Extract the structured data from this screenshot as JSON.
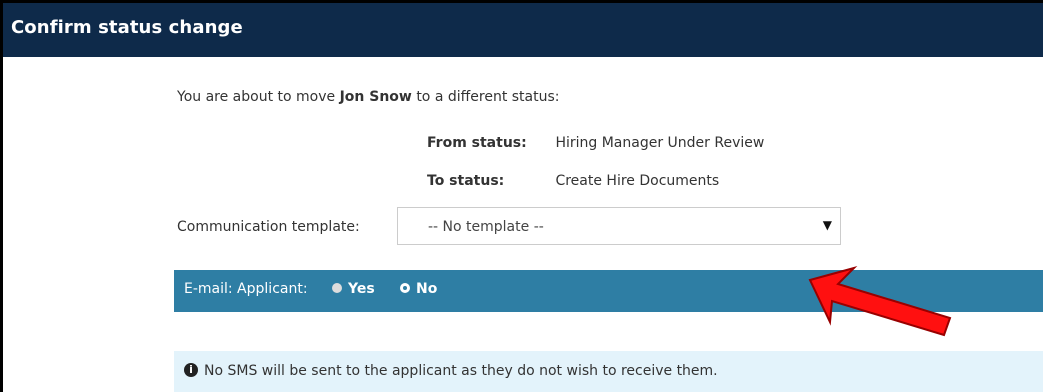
{
  "dialog": {
    "title": "Confirm status change"
  },
  "message": {
    "prefix": "You are about to move",
    "applicant_name": "Jon Snow",
    "suffix": "to a different status:"
  },
  "status": {
    "from_label": "From status:",
    "from_value": "Hiring Manager Under Review",
    "to_label": "To status:",
    "to_value": "Create Hire Documents"
  },
  "communication": {
    "label": "Communication template:",
    "selected": "-- No template --",
    "caret": "▼"
  },
  "email": {
    "label": "E-mail: Applicant:",
    "yes_label": "Yes",
    "no_label": "No",
    "selected": "No"
  },
  "info": {
    "icon": "info-circle-icon",
    "text": "No SMS will be sent to the applicant as they do not wish to receive them."
  },
  "colors": {
    "titlebar": "#0e2a4a",
    "email_bar": "#2e7ea4",
    "info_bar": "#e3f3fb",
    "arrow": "#ff1010"
  }
}
